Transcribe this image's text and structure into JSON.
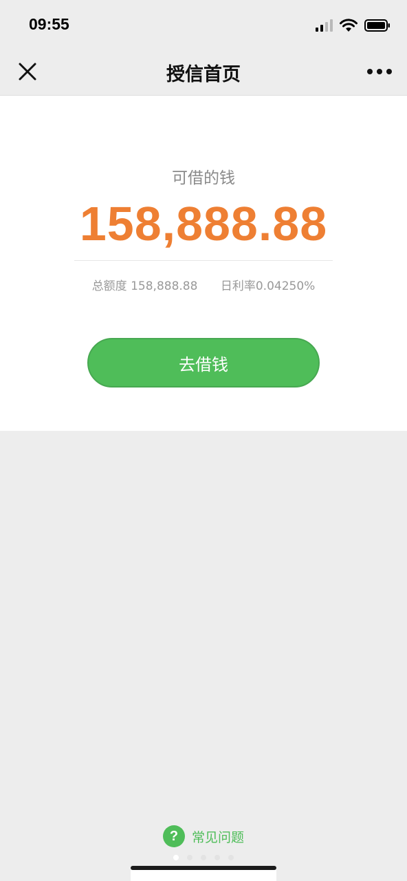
{
  "status_bar": {
    "time": "09:55",
    "icons": [
      "cellular-signal-icon",
      "wifi-icon",
      "battery-icon"
    ]
  },
  "navbar": {
    "close_icon": "close-icon",
    "title": "授信首页",
    "more_icon": "more-icon"
  },
  "credit": {
    "label": "可借的钱",
    "amount": "158,888.88",
    "total_limit": "总额度 158,888.88",
    "daily_rate": "日利率0.04250%",
    "borrow_button": "去借钱"
  },
  "faq": {
    "icon": "question-icon",
    "label": "常见问题"
  },
  "colors": {
    "amount": "#ee7f33",
    "primary_green": "#4fbd59",
    "background": "#ededed"
  }
}
